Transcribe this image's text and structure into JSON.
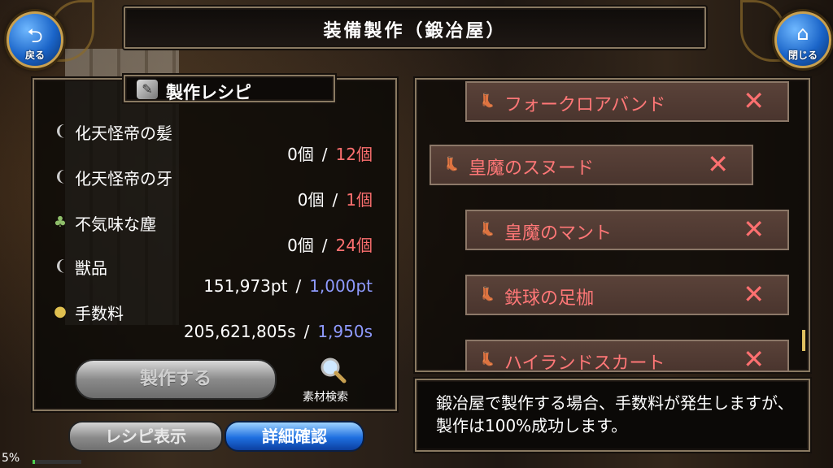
{
  "header": {
    "title": "装備製作（鍛冶屋）"
  },
  "nav": {
    "back_label": "戻る",
    "close_label": "閉じる",
    "back_icon": "back-arrow-icon",
    "close_icon": "home-icon"
  },
  "recipe": {
    "title": "製作レシピ",
    "materials": [
      {
        "name": "化天怪帝の髪",
        "have": "0個",
        "sep": "/",
        "need": "12個",
        "icon": "claw-icon"
      },
      {
        "name": "化天怪帝の牙",
        "have": "0個",
        "sep": "/",
        "need": "1個",
        "icon": "claw-icon"
      },
      {
        "name": "不気味な塵",
        "have": "0個",
        "sep": "/",
        "need": "24個",
        "icon": "dust-bag-icon"
      },
      {
        "name": "獣品",
        "have": "151,973pt",
        "sep": "/",
        "need": "1,000pt",
        "icon": "claw-icon"
      },
      {
        "name": "手数料",
        "have": "205,621,805s",
        "sep": "/",
        "need": "1,950s",
        "icon": "coins-icon"
      }
    ],
    "craft_label": "製作する",
    "search_label": "素材検索"
  },
  "buttons": {
    "recipe_view": "レシピ表示",
    "detail": "詳細確認"
  },
  "equipment_list": [
    {
      "name": "フォークロアバンド"
    },
    {
      "name": "皇魔のスヌード"
    },
    {
      "name": "皇魔のマント"
    },
    {
      "name": "鉄球の足枷"
    },
    {
      "name": "ハイランドスカート"
    }
  ],
  "info": {
    "text": "鍛冶屋で製作する場合、手数料が発生しますが、製作は100%成功します。"
  },
  "status": {
    "stamina": "5%",
    "stamina_fraction": 0.05
  },
  "colors": {
    "need_red": "#ff7070",
    "need_blue": "#8f9bff",
    "item_name": "#ff7777"
  }
}
